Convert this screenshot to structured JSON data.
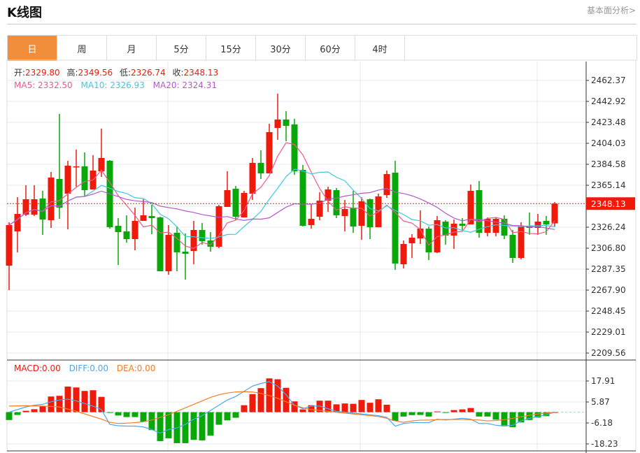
{
  "header": {
    "title": "K线图",
    "link": "基本面分析>"
  },
  "tabs": [
    {
      "label": "日",
      "active": true
    },
    {
      "label": "周"
    },
    {
      "label": "月"
    },
    {
      "label": "5分"
    },
    {
      "label": "15分"
    },
    {
      "label": "30分"
    },
    {
      "label": "60分"
    },
    {
      "label": "4时"
    }
  ],
  "legend": {
    "open_label": "开:",
    "open": "2329.80",
    "high_label": "高:",
    "high": "2349.56",
    "low_label": "低:",
    "low": "2326.74",
    "close_label": "收:",
    "close": "2348.13",
    "ma5": "MA5: 2332.50",
    "ma10": "MA10: 2326.93",
    "ma20": "MA20: 2324.31",
    "macd": "MACD:0.00",
    "diff": "DIFF:0.00",
    "dea": "DEA:0.00"
  },
  "colors": {
    "up": "#f01a0a",
    "down": "#08a808",
    "ma5": "#ec5a8a",
    "ma10": "#40c8dc",
    "ma20": "#b45ac8",
    "diff": "#4aa8f0",
    "dea": "#f57c24",
    "tab_active": "#f28d3c"
  },
  "chart_data": [
    {
      "type": "candlestick",
      "title": "K线图",
      "y_ticks": [
        "2462.37",
        "2442.92",
        "2423.48",
        "2404.03",
        "2384.58",
        "2365.14",
        "2345.69",
        "2326.24",
        "2306.80",
        "2287.35",
        "2267.90",
        "2248.45",
        "2229.01",
        "2209.56"
      ],
      "ylim": [
        2209.56,
        2462.37
      ],
      "last_price": "2348.13",
      "ohlc": [
        [
          2290.59,
          2330.78,
          2267.91,
          2328.19
        ],
        [
          2322.35,
          2354.11,
          2302.91,
          2338.56
        ],
        [
          2337.91,
          2365.14,
          2336.61,
          2352.17
        ],
        [
          2337.91,
          2365.14,
          2336.61,
          2352.17
        ],
        [
          2352.82,
          2359.95,
          2319.17,
          2333.36
        ],
        [
          2332.72,
          2377.45,
          2325.6,
          2372.27
        ],
        [
          2370.97,
          2431.25,
          2334.01,
          2344.39
        ],
        [
          2357.36,
          2387.82,
          2324.3,
          2383.29
        ],
        [
          2381.99,
          2398.2,
          2363.84,
          2382.64
        ],
        [
          2382.64,
          2395.6,
          2354.77,
          2360.6
        ],
        [
          2361.25,
          2393.01,
          2361.25,
          2378.75
        ],
        [
          2378.1,
          2417.64,
          2372.92,
          2390.42
        ],
        [
          2387.82,
          2388.47,
          2324.95,
          2326.25
        ],
        [
          2327.55,
          2334.67,
          2291.24,
          2321.72
        ],
        [
          2322.35,
          2337.26,
          2311.98,
          2315.22
        ],
        [
          2315.22,
          2344.39,
          2304.86,
          2332.08
        ],
        [
          2332.08,
          2352.17,
          2332.08,
          2337.26
        ],
        [
          2336.61,
          2346.98,
          2319.76,
          2334.67
        ],
        [
          2335.31,
          2335.96,
          2285.41,
          2285.41
        ],
        [
          2285.41,
          2328.19,
          2282.17,
          2319.17
        ],
        [
          2321.06,
          2326.89,
          2285.41,
          2302.91
        ],
        [
          2303.56,
          2320.41,
          2277.63,
          2301.62
        ],
        [
          2304.21,
          2332.08,
          2291.89,
          2323.65
        ],
        [
          2323.65,
          2330.13,
          2310.04,
          2313.28
        ],
        [
          2313.93,
          2321.71,
          2303.56,
          2308.12
        ],
        [
          2308.12,
          2346.98,
          2306.8,
          2345.69
        ],
        [
          2345.04,
          2378.1,
          2345.04,
          2360.6
        ],
        [
          2361.9,
          2364.49,
          2332.72,
          2335.96
        ],
        [
          2335.31,
          2359.95,
          2335.31,
          2358.01
        ],
        [
          2357.36,
          2390.42,
          2351.52,
          2385.88
        ],
        [
          2385.88,
          2397.55,
          2370.97,
          2376.16
        ],
        [
          2376.16,
          2422.18,
          2376.16,
          2414.4
        ],
        [
          2418.29,
          2450.05,
          2407.27,
          2426.07
        ],
        [
          2426.07,
          2433.84,
          2405.97,
          2420.23
        ],
        [
          2421.53,
          2426.72,
          2374.86,
          2378.1
        ],
        [
          2379.4,
          2383.94,
          2326.89,
          2327.55
        ],
        [
          2328.19,
          2347.63,
          2324.95,
          2334.01
        ],
        [
          2335.96,
          2358.66,
          2332.72,
          2350.87
        ],
        [
          2350.87,
          2363.84,
          2340.5,
          2361.25
        ],
        [
          2360.6,
          2362.55,
          2334.67,
          2337.26
        ],
        [
          2336.61,
          2351.52,
          2322.35,
          2343.09
        ],
        [
          2344.39,
          2359.95,
          2321.06,
          2326.89
        ],
        [
          2327.55,
          2354.11,
          2314.57,
          2350.23
        ],
        [
          2352.17,
          2352.82,
          2315.22,
          2326.25
        ],
        [
          2326.25,
          2357.36,
          2326.25,
          2354.77
        ],
        [
          2356.06,
          2378.75,
          2353.47,
          2375.51
        ],
        [
          2376.8,
          2387.82,
          2286.71,
          2292.54
        ],
        [
          2291.89,
          2313.93,
          2288.0,
          2310.69
        ],
        [
          2311.34,
          2319.76,
          2297.72,
          2316.52
        ],
        [
          2315.87,
          2341.8,
          2310.69,
          2324.95
        ],
        [
          2324.95,
          2326.89,
          2295.78,
          2302.91
        ],
        [
          2302.91,
          2336.61,
          2302.26,
          2332.72
        ],
        [
          2331.43,
          2332.72,
          2310.04,
          2318.47
        ],
        [
          2318.47,
          2333.37,
          2306.15,
          2329.49
        ],
        [
          2329.49,
          2334.67,
          2323.65,
          2327.55
        ],
        [
          2328.84,
          2365.79,
          2328.84,
          2359.95
        ],
        [
          2360.6,
          2369.03,
          2316.52,
          2321.06
        ],
        [
          2321.06,
          2335.31,
          2317.82,
          2334.01
        ],
        [
          2321.06,
          2335.31,
          2317.82,
          2334.01
        ],
        [
          2334.01,
          2337.26,
          2315.22,
          2318.47
        ],
        [
          2319.17,
          2323.65,
          2293.19,
          2297.72
        ],
        [
          2297.72,
          2330.78,
          2296.42,
          2326.89
        ],
        [
          2327.55,
          2339.85,
          2319.17,
          2325.6
        ],
        [
          2325.6,
          2338.56,
          2319.17,
          2331.43
        ],
        [
          2332.08,
          2336.61,
          2319.17,
          2328.84
        ],
        [
          2329.8,
          2349.56,
          2326.74,
          2348.13
        ]
      ]
    },
    {
      "type": "macd",
      "y_ticks": [
        "17.91",
        "5.87",
        "-6.18",
        "-18.23"
      ],
      "ylim": [
        -18.23,
        17.91
      ],
      "hist": [
        -4.5,
        -1.6,
        0.8,
        1.7,
        3.3,
        9.0,
        9.4,
        14.7,
        14.2,
        12.2,
        12.6,
        8.8,
        -0.3,
        -1.9,
        -2.8,
        -2.8,
        -5.5,
        -10.3,
        -16.6,
        -15.0,
        -17.8,
        -17.8,
        -15.9,
        -16.2,
        -13.5,
        -7.2,
        -4.7,
        -3.2,
        4.0,
        10.4,
        13.8,
        19.4,
        18.9,
        14.0,
        6.2,
        1.6,
        4.0,
        6.6,
        6.6,
        4.5,
        5.0,
        4.8,
        7.0,
        5.4,
        7.4,
        4.3,
        -5.0,
        -2.5,
        -1.7,
        -1.6,
        -2.5,
        0.4,
        -0.4,
        1.2,
        1.6,
        2.4,
        -2.5,
        -2.5,
        -4.3,
        -7.6,
        -8.6,
        -5.9,
        -4.5,
        -3.1,
        -2.3,
        0
      ],
      "diff": [
        0,
        1.5,
        3,
        4,
        4.5,
        6,
        7,
        7.5,
        6.5,
        5,
        3.5,
        1.5,
        -7,
        -7.8,
        -8,
        -8,
        -8.5,
        -10,
        -12,
        -10,
        -9,
        -7,
        -4,
        -2,
        1,
        4,
        7,
        9,
        12,
        15,
        16.5,
        17.5,
        15,
        10,
        4,
        2,
        3.5,
        3.5,
        2,
        0.5,
        0,
        -0.5,
        -1,
        -1.5,
        -2,
        -3,
        -8,
        -6.5,
        -6,
        -6,
        -6,
        -4,
        -4.5,
        -4,
        -3.5,
        -4,
        -6.5,
        -6.5,
        -7.5,
        -8,
        -7.5,
        -5,
        -3.5,
        -2.5,
        -1.5,
        0
      ],
      "dea": [
        3.5,
        3.6,
        3.7,
        3.6,
        3.5,
        3.3,
        3.0,
        1.8,
        0.5,
        -1,
        -2.5,
        -4,
        -5.8,
        -6.5,
        -6.3,
        -6,
        -5.5,
        -4.5,
        -3,
        -1.5,
        0.5,
        2.5,
        4.5,
        6.5,
        8.5,
        10,
        11,
        11.6,
        11.8,
        11.6,
        10.8,
        9.5,
        8,
        6,
        4,
        2.5,
        1.5,
        1,
        0.5,
        0,
        -0.5,
        -1,
        -1.5,
        -2,
        -2.5,
        -3.5,
        -5,
        -5.8,
        -5,
        -4.6,
        -4.5,
        -4.3,
        -4.2,
        -4.2,
        -4.2,
        -4.3,
        -4.5,
        -5,
        -4.8,
        -4.3,
        -3.5,
        -2.6,
        -1.8,
        -1.0,
        -0.5,
        0
      ]
    }
  ]
}
